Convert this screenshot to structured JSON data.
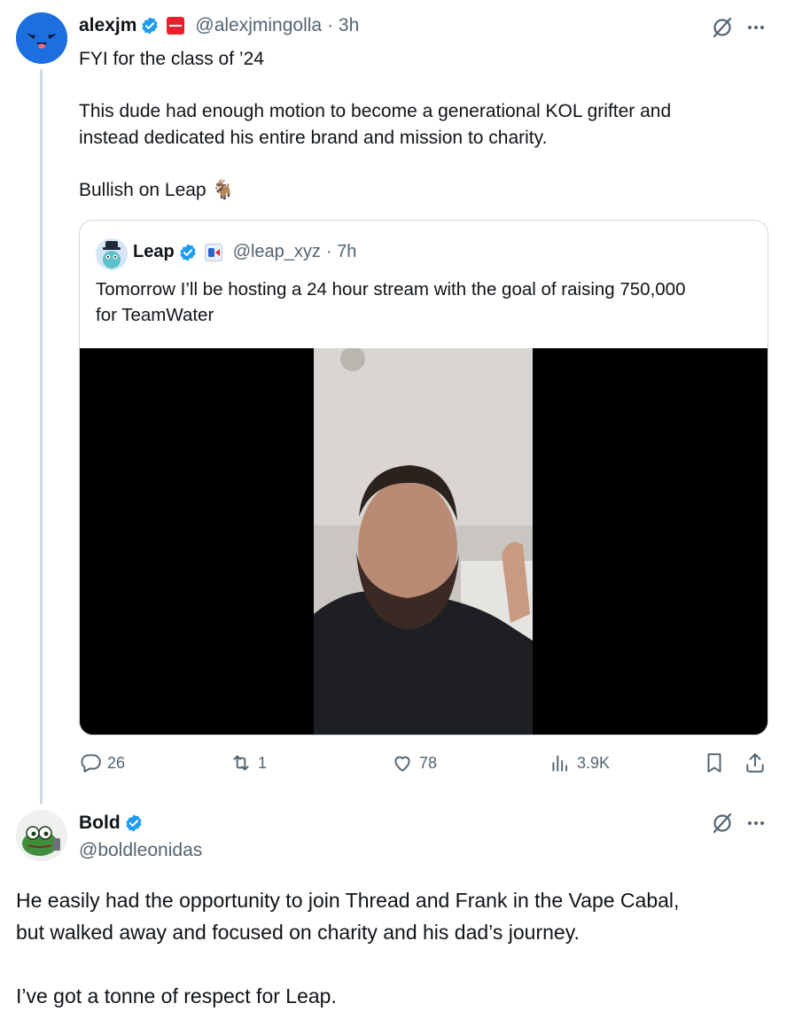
{
  "tweet1": {
    "display_name": "alexjm",
    "handle": "@alexjmingolla",
    "time": "· 3h",
    "text": "FYI for the class of ’24\n\nThis dude had enough motion to become a generational KOL grifter and\ninstead dedicated his entire brand and mission to charity.\n\nBullish on Leap 🐐",
    "quote": {
      "display_name": "Leap",
      "handle": "@leap_xyz",
      "time": "· 7h",
      "text": "Tomorrow I’ll be hosting a 24 hour stream with the goal of raising 750,000\nfor TeamWater"
    },
    "actions": {
      "replies": "26",
      "reposts": "1",
      "likes": "78",
      "views": "3.9K"
    }
  },
  "tweet2": {
    "display_name": "Bold",
    "handle": "@boldleonidas",
    "text": "He easily had the opportunity to join Thread and Frank in the Vape Cabal,\nbut walked away and focused on charity and his dad’s journey.\n\nI’ve got a tonne of respect for Leap."
  },
  "colors": {
    "verified": "#1d9bf0",
    "muted": "#536471",
    "border": "#cfd9de"
  },
  "icons": [
    "grok-icon",
    "more-icon",
    "reply-icon",
    "repost-icon",
    "like-icon",
    "views-icon",
    "bookmark-icon",
    "share-icon",
    "verified-badge-icon"
  ]
}
